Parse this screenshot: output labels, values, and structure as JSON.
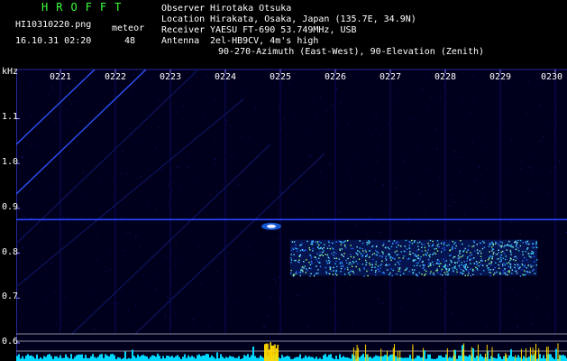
{
  "header": {
    "app_title": "HROFFT",
    "file_name": "HI10310220.png",
    "date_time": "16.10.31 02:20",
    "stat_label": "meteor",
    "stat_value": "48"
  },
  "info": [
    {
      "key": "Observer",
      "value": "Hirotaka Otsuka"
    },
    {
      "key": "Location",
      "value": "Hirakata, Osaka, Japan (135.7E, 34.9N)"
    },
    {
      "key": "Receiver",
      "value": "YAESU FT-690 53.749MHz, USB"
    },
    {
      "key": "Antenna",
      "value": "2el-HB9CV, 4m's high"
    },
    {
      "key": "",
      "value": "90-270-Azimuth (East-West), 90-Elevation (Zenith)"
    }
  ],
  "chart_data": {
    "type": "heatmap",
    "ylabel": "kHz",
    "x_ticks": [
      "0221",
      "0222",
      "0223",
      "0224",
      "0225",
      "0226",
      "0227",
      "0228",
      "0229",
      "0230"
    ],
    "y_ticks": [
      "1.1",
      "1.0",
      "0.9",
      "0.8",
      "0.7",
      "0.6"
    ],
    "ylim": [
      0.58,
      1.17
    ],
    "carrier_khz": 0.875,
    "meteor_echo": {
      "time": "0225",
      "khz": 0.86
    },
    "band": {
      "start": "0226",
      "end": "0230",
      "khz_low": 0.75,
      "khz_high": 0.83
    },
    "colors": {
      "background": "#00001c",
      "carrier": "#2a46ff",
      "echo": "#28c0ff",
      "grid": "#26269a",
      "level": "#00d8ff",
      "peak": "#ffd800"
    }
  }
}
